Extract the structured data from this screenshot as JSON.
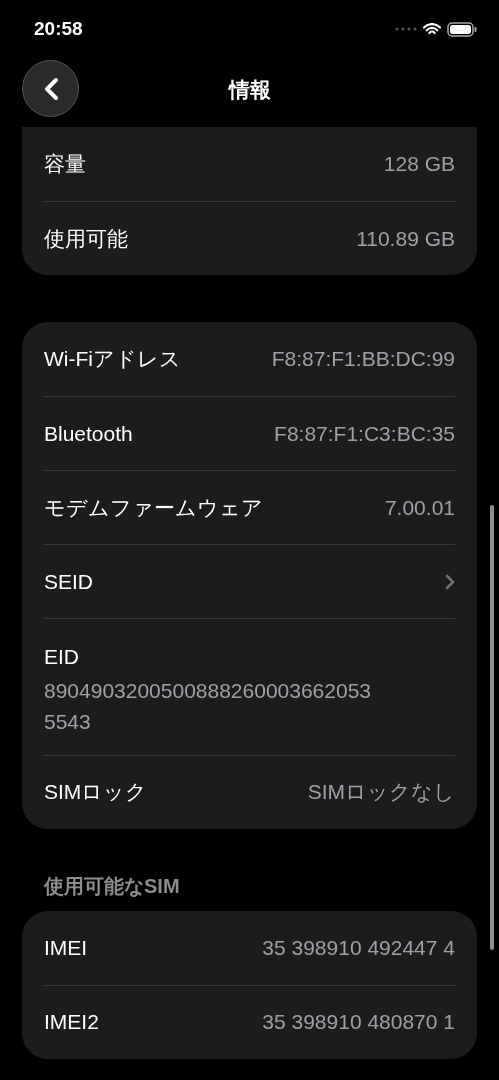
{
  "status_bar": {
    "time": "20:58"
  },
  "nav": {
    "title": "情報"
  },
  "groups": [
    {
      "cut_top": true,
      "rows": [
        {
          "kind": "value",
          "label": "容量",
          "value": "128 GB"
        },
        {
          "kind": "value",
          "label": "使用可能",
          "value": "110.89 GB"
        }
      ]
    },
    {
      "cut_top": false,
      "rows": [
        {
          "kind": "value",
          "label": "Wi-Fiアドレス",
          "value": "F8:87:F1:BB:DC:99"
        },
        {
          "kind": "value",
          "label": "Bluetooth",
          "value": "F8:87:F1:C3:BC:35"
        },
        {
          "kind": "value",
          "label": "モデムファームウェア",
          "value": "7.00.01"
        },
        {
          "kind": "link",
          "label": "SEID"
        },
        {
          "kind": "stacked",
          "label": "EID",
          "value": "89049032005008882600036620535543"
        },
        {
          "kind": "value",
          "label": "SIMロック",
          "value": "SIMロックなし"
        }
      ]
    },
    {
      "header": "使用可能なSIM",
      "cut_top": false,
      "rows": [
        {
          "kind": "value",
          "label": "IMEI",
          "value": "35 398910 492447 4"
        },
        {
          "kind": "value",
          "label": "IMEI2",
          "value": "35 398910 480870 1"
        }
      ]
    }
  ]
}
